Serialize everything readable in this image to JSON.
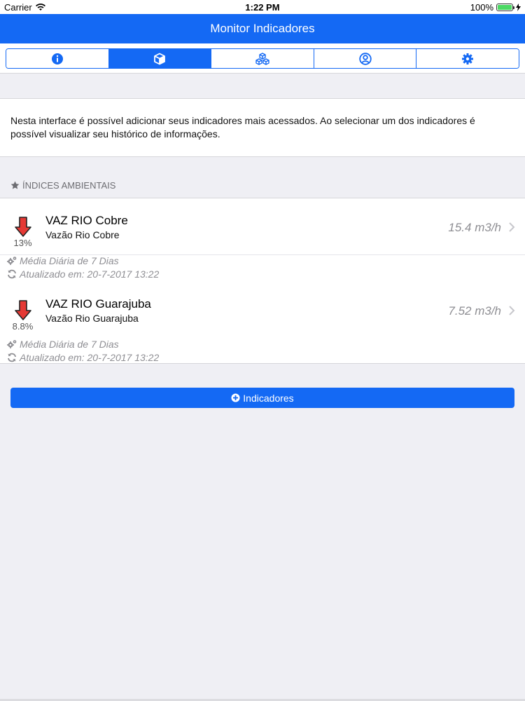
{
  "status": {
    "carrier": "Carrier",
    "time": "1:22 PM",
    "battery": "100%"
  },
  "navbar": {
    "title": "Monitor Indicadores"
  },
  "tabs": [
    {
      "icon": "info-circle-icon",
      "active": false
    },
    {
      "icon": "cube-icon",
      "active": true
    },
    {
      "icon": "cubes-icon",
      "active": false
    },
    {
      "icon": "user-circle-icon",
      "active": false
    },
    {
      "icon": "gear-icon",
      "active": false
    }
  ],
  "intro": {
    "text": "Nesta interface é possível adicionar seus indicadores mais acessados. Ao selecionar um dos indicadores é possível visualizar seu histórico de informações."
  },
  "section": {
    "title": "ÍNDICES AMBIENTAIS",
    "icon": "star-icon"
  },
  "items": [
    {
      "name": "VAZ RIO Cobre",
      "description": "Vazão Rio Cobre",
      "percent": "13%",
      "value": "15.4 m3/h",
      "period": "Média Diária de 7 Dias",
      "updated": "Atualizado em: 20-7-2017 13:22",
      "trend": "down"
    },
    {
      "name": "VAZ RIO Guarajuba",
      "description": "Vazão Rio Guarajuba",
      "percent": "8.8%",
      "value": "7.52 m3/h",
      "period": "Média Diária de 7 Dias",
      "updated": "Atualizado em: 20-7-2017 13:22",
      "trend": "down"
    }
  ],
  "button": {
    "label": "Indicadores",
    "icon": "plus-circle-icon"
  },
  "colors": {
    "accent": "#1469f4",
    "trend_down": "#e53935"
  }
}
